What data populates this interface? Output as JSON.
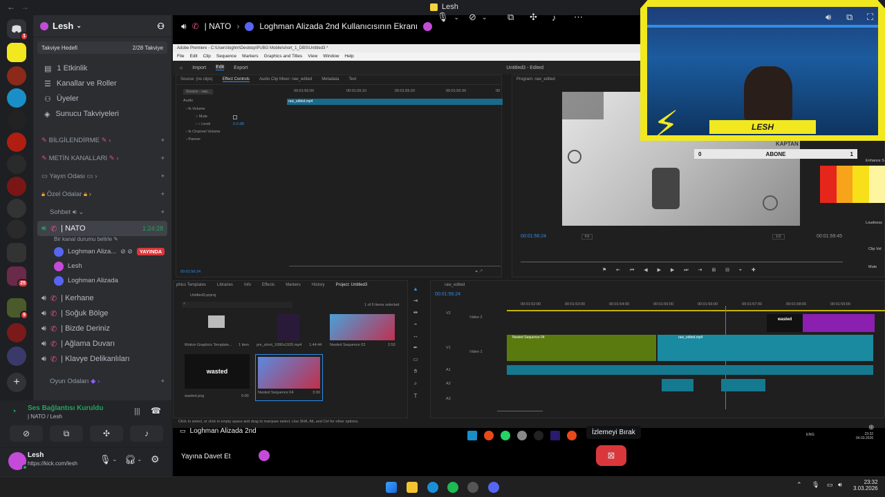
{
  "window": {
    "title": "Lesh",
    "nav_back": "←",
    "nav_fwd": "→"
  },
  "server": {
    "name": "Lesh",
    "boost_goal": "Takviye Hedefi",
    "boost_count": "2/28 Takviye",
    "nav": [
      "1 Etkinlik",
      "Kanallar ve Roller",
      "Üyeler",
      "Sunucu Takviyeleri"
    ],
    "categories": {
      "bilgilendirme": "BİLGİLENDİRME",
      "metin": "METİN KANALLARI",
      "yayin": "Yayın Odası",
      "ozel": "Özel Odalar",
      "sohbet": "Sohbet",
      "oyun": "Oyun Odaları"
    },
    "active_channel": {
      "name": "| NATO",
      "time": "1:24:28",
      "topic": "Bir kanal durumu belirle"
    },
    "voice_users": [
      {
        "name": "Loghman Aliza...",
        "live": "YAYINDA"
      },
      {
        "name": "Lesh"
      },
      {
        "name": "Loghman Alizada"
      }
    ],
    "voice_channels": [
      "| Kerhane",
      "| Soğuk Bölge",
      "| Bizde Deriniz",
      "| Ağlama Duvarı",
      "| Klavye Delikanlıları"
    ]
  },
  "voice_panel": {
    "status": "Ses Bağlantısı Kuruldu",
    "channel": "| NATO / Lesh"
  },
  "user_panel": {
    "name": "Lesh",
    "status": "https://kick.com/lesh"
  },
  "stream": {
    "channel": "| NATO",
    "title": "Loghman Alizada 2nd Kullanıcısının Ekranı",
    "streamer_label": "Loghman Alizada 2nd",
    "tooltip": "İzlemeyi Bırak",
    "invite": "Yayına Davet Et"
  },
  "premiere": {
    "title": "Adobe Premiere - C:\\Users\\loghm\\Desktop\\PUBG Mobile\\short_1_DBS\\Untitled3 *",
    "menu": [
      "File",
      "Edit",
      "Clip",
      "Sequence",
      "Markers",
      "Graphics and Titles",
      "View",
      "Window",
      "Help"
    ],
    "tabs": [
      "Import",
      "Edit",
      "Export"
    ],
    "project_name": "Untitled3 - Edited",
    "source_tabs": [
      "Source: (no clips)",
      "Effect Controls",
      "Audio Clip Mixer: raw_edited",
      "Metadata",
      "Text"
    ],
    "source_clip": "Source - raw...",
    "clip_name": "raw_edited.mp4",
    "timecodes_top": [
      "00:01:55:00",
      "00:01:55:10",
      "00:01:55:20",
      "00:01:55:30",
      "00"
    ],
    "effects": [
      "Audio",
      "Volume",
      "Mute",
      "Level",
      "Channel Volume",
      "Panner"
    ],
    "level_value": "0.0 dB",
    "source_time": "00:01:56:24",
    "program_label": "Program: raw_edited",
    "program_time": "00:01:56:24",
    "program_fit": "Fit",
    "program_quality": "1/2",
    "program_duration": "00:01:59:45",
    "bins_tabs": [
      "phics Templates",
      "Libraries",
      "Info",
      "Effects",
      "Markers",
      "History",
      "Project: Untitled3"
    ],
    "project_file": "Untitled3.prproj",
    "items_selected": "1 of 6 items selected",
    "bins": [
      {
        "name": "Motion Graphics Template...",
        "meta": "1 item"
      },
      {
        "name": "pm_short_1080x1920.mp4",
        "meta": "1:44:44"
      },
      {
        "name": "Nested Sequence 02",
        "meta": "2:53"
      },
      {
        "name": "wasted.png",
        "meta": "5:00"
      },
      {
        "name": "Nested Sequence 04",
        "meta": "3:00"
      }
    ],
    "bin_wasted_text": "wasted",
    "timeline_tab": "raw_edited",
    "timeline_time": "00:01:56:24",
    "ruler": [
      "00:01:52:00",
      "00:01:53:00",
      "00:01:54:00",
      "00:01:55:00",
      "00:01:56:00",
      "00:01:57:00",
      "00:01:58:00",
      "00:01:59:00"
    ],
    "tracks": [
      "V2",
      "V1",
      "A1",
      "A2",
      "A3"
    ],
    "track_labels": {
      "v2": "Video 2",
      "v1": "Video 1"
    },
    "clips": {
      "nested": "Nested Sequence 04",
      "raw": "raw_edited.mp4",
      "wasted": "wasted"
    },
    "status_hint": "Click to select, or click in empty space and drag to marquee select. Use Shift, Alt, and Ctrl for other options."
  },
  "overlay": {
    "name": "LESH",
    "abone": "ABONE",
    "abone_left": "0",
    "abone_right": "1",
    "kaptan": "KAPTAN",
    "side": [
      "Enhance S",
      "Loudness",
      "Clip Vol",
      "Mute"
    ]
  },
  "taskbar": {
    "time": "23:32",
    "date": "3.03.2026",
    "remote_time": "23:32",
    "remote_date": "04.03.2026",
    "lang": "ENG"
  },
  "colors": {
    "discord_bg": "#1e1f22",
    "channel_bg": "#2b2d31",
    "live_red": "#da373c",
    "cam_yellow": "#f2e81f",
    "accent_blue": "#5865f2"
  }
}
